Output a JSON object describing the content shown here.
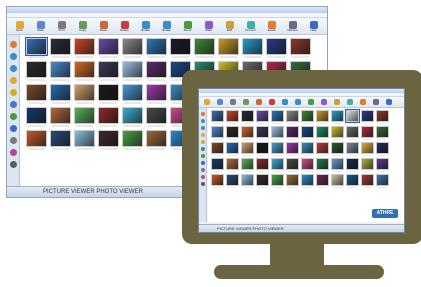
{
  "app": {
    "status_text": "PICTURE VIEWER PHOTO VIEWER",
    "badge_text": "ATHRE"
  },
  "toolbar_buttons": [
    {
      "icon": "folder-icon",
      "label": "Open",
      "color": "#e0a838"
    },
    {
      "icon": "save-icon",
      "label": "Save",
      "color": "#5b86c8"
    },
    {
      "icon": "print-icon",
      "label": "Print",
      "color": "#7b7b7b"
    },
    {
      "icon": "copy-icon",
      "label": "Copy",
      "color": "#6a9a5a"
    },
    {
      "icon": "move-icon",
      "label": "Move",
      "color": "#c86a3c"
    },
    {
      "icon": "delete-icon",
      "label": "Delete",
      "color": "#c83c3c"
    },
    {
      "icon": "rotate-left-icon",
      "label": "Rotate",
      "color": "#3c8cc8"
    },
    {
      "icon": "rotate-right-icon",
      "label": "Rotate",
      "color": "#3c8cc8"
    },
    {
      "icon": "zoom-icon",
      "label": "Zoom",
      "color": "#4a9a3a"
    },
    {
      "icon": "slideshow-icon",
      "label": "Slide",
      "color": "#8a5ac8"
    },
    {
      "icon": "edit-icon",
      "label": "Edit",
      "color": "#c8a03c"
    },
    {
      "icon": "convert-icon",
      "label": "Convert",
      "color": "#3cb0b0"
    },
    {
      "icon": "email-icon",
      "label": "Email",
      "color": "#e07a2c"
    },
    {
      "icon": "settings-icon",
      "label": "Options",
      "color": "#6a6a8a"
    },
    {
      "icon": "help-icon",
      "label": "Help",
      "color": "#3c6ac8"
    }
  ],
  "sidebar_icons": [
    {
      "icon": "home-icon",
      "color": "#e07a2c"
    },
    {
      "icon": "back-icon",
      "color": "#3c8cc8"
    },
    {
      "icon": "forward-icon",
      "color": "#3c8cc8"
    },
    {
      "icon": "folder-icon",
      "color": "#e0a838"
    },
    {
      "icon": "favorites-icon",
      "color": "#d4b020"
    },
    {
      "icon": "search-icon",
      "color": "#4a7ab0"
    },
    {
      "icon": "refresh-icon",
      "color": "#4a9a3a"
    },
    {
      "icon": "info-icon",
      "color": "#3c6ac8"
    },
    {
      "icon": "filter-icon",
      "color": "#7a7a7a"
    },
    {
      "icon": "tag-icon",
      "color": "#b04a8a"
    },
    {
      "icon": "camera-icon",
      "color": "#5a5a5a"
    }
  ],
  "thumbs_back": [
    "#3a6fb0",
    "#2b2b3a",
    "#c8472a",
    "#6a4aa8",
    "#8a8a8a",
    "#2a7ab8",
    "#1a1a2a",
    "#3c8c3c",
    "#c89a2a",
    "#2a9ac8",
    "#2a3a8a",
    "#8a3a2a",
    "#2a2a2a",
    "#4a8ad0",
    "#d06a2a",
    "#3a3a5a",
    "#9ac0e0",
    "#5a2a6a",
    "#1a4a8a",
    "#2a8a6a",
    "#c8c02a",
    "#6a6a6a",
    "#b02a4a",
    "#3a6a3a",
    "#7a4a2a",
    "#2a6ab0",
    "#d0a06a",
    "#1a1a1a",
    "#4a9ad0",
    "#9a3aa8",
    "#3a8ac0",
    "#c03a3a",
    "#2a5a2a",
    "#7a8aa0",
    "#e0b040",
    "#2a2a5a",
    "#1a3a6a",
    "#b06a3a",
    "#5ab05a",
    "#8a2a2a",
    "#3ab0d0",
    "#4a4a4a",
    "#d04a8a",
    "#2a7a4a",
    "#6a9ad0",
    "#1a2a4a",
    "#b0b040",
    "#5a3a8a",
    "#c05a2a",
    "#2a4a7a",
    "#8ac0e0",
    "#3a2a2a",
    "#4aa04a",
    "#9a6a3a",
    "#2a8ad0",
    "#6a2a5a",
    "#d0c0a0",
    "#1a5a8a",
    "#a03a3a",
    "#3a7ab0"
  ],
  "thumbs_front": [
    "#3a6fb0",
    "#c8472a",
    "#2b2b3a",
    "#6a4aa8",
    "#2a7ab8",
    "#8a8a8a",
    "#3c8c3c",
    "#c89a2a",
    "#2a9ac8",
    "#e0e0e0",
    "#2a3a8a",
    "#8a3a2a",
    "#4a8ad0",
    "#2a2a2a",
    "#d06a2a",
    "#3a3a5a",
    "#9ac0e0",
    "#5a2a6a",
    "#1a4a8a",
    "#2a8a6a",
    "#c8c02a",
    "#6a6a6a",
    "#b02a4a",
    "#3a6a3a",
    "#7a4a2a",
    "#2a6ab0",
    "#d0a06a",
    "#1a1a1a",
    "#4a9ad0",
    "#9a3aa8",
    "#3a8ac0",
    "#c03a3a",
    "#2a5a2a",
    "#7a8aa0",
    "#e0b040",
    "#2a2a5a",
    "#1a3a6a",
    "#b06a3a",
    "#5ab05a",
    "#8a2a2a",
    "#3ab0d0",
    "#4a4a4a",
    "#d04a8a",
    "#2a7a4a",
    "#6a9ad0",
    "#1a2a4a",
    "#b0b040",
    "#5a3a8a",
    "#c05a2a",
    "#2a4a7a",
    "#8ac0e0",
    "#3a2a2a",
    "#4aa04a",
    "#9a6a3a",
    "#2a8ad0",
    "#6a2a5a",
    "#d0c0a0",
    "#1a5a8a",
    "#a03a3a",
    "#3a7ab0"
  ],
  "colors": {
    "monitor": "#6b6440",
    "selection": "#2a5fc0"
  }
}
